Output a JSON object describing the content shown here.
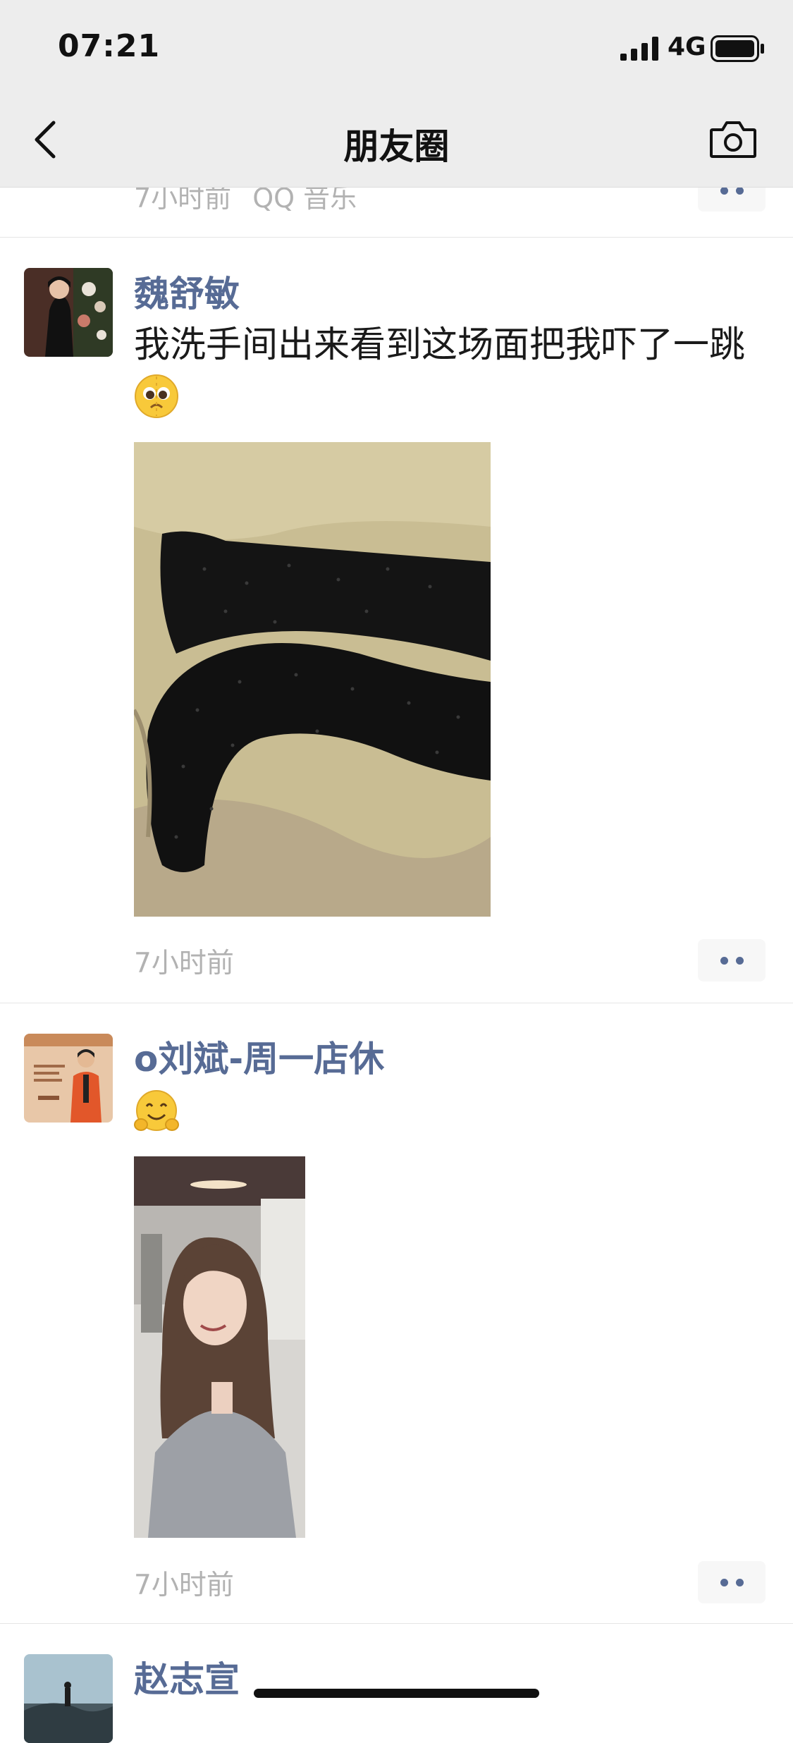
{
  "status_bar": {
    "time": "07:21",
    "network": "4G"
  },
  "nav": {
    "title": "朋友圈"
  },
  "previous_post": {
    "time": "7小时前",
    "source": "QQ 音乐"
  },
  "posts": [
    {
      "username": "魏舒敏",
      "text": "我洗手间出来看到这场面把我吓了一跳",
      "emoji": "pleading-face-emoji",
      "time": "7小时前"
    },
    {
      "username": "o刘斌-周一店休",
      "text": "",
      "emoji": "hugging-face-emoji",
      "time": "7小时前"
    },
    {
      "username": "赵志宣"
    }
  ],
  "icons": {
    "back": "chevron-left-icon",
    "camera": "camera-icon",
    "more": "more-dots-icon"
  },
  "colors": {
    "link": "#576b95",
    "time": "#b2b2b2",
    "topbar": "#ededed"
  }
}
